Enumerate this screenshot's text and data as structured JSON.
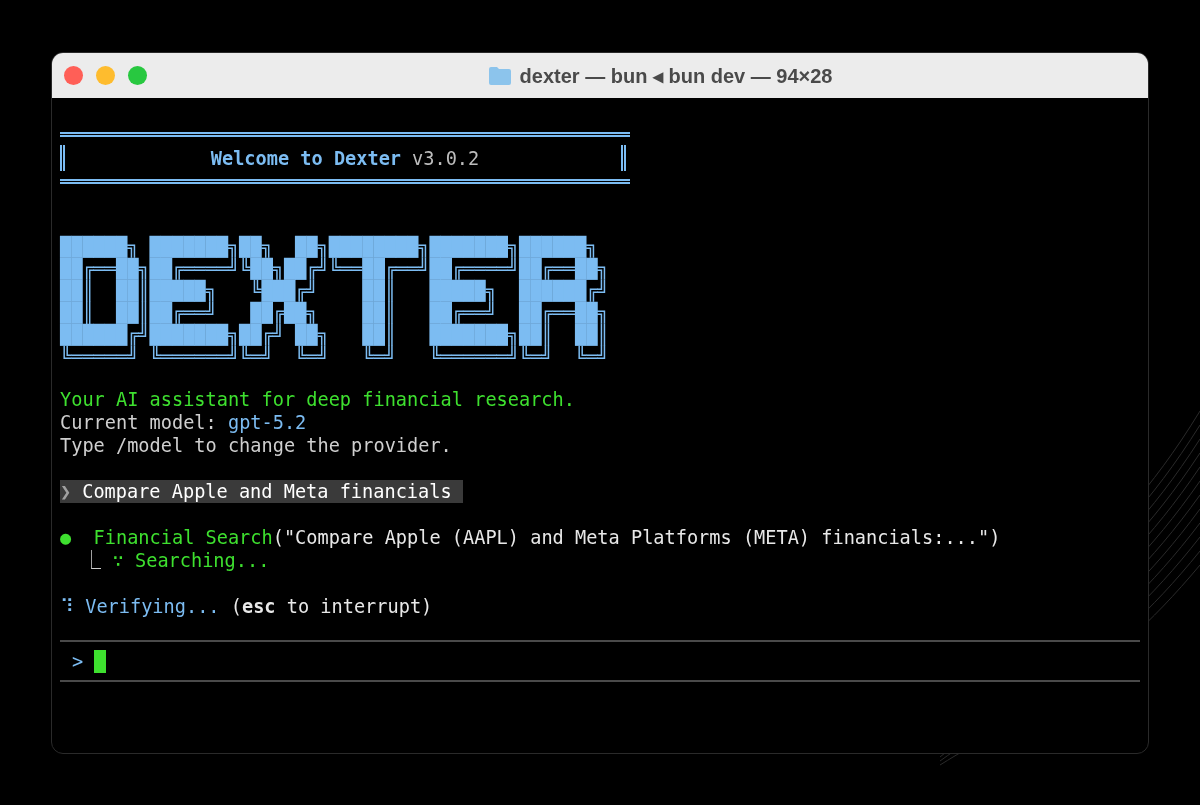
{
  "window": {
    "title": "dexter — bun ◂ bun dev — 94×28"
  },
  "welcome": {
    "title": "Welcome to Dexter",
    "version": "v3.0.2"
  },
  "banner_art": [
    "██████╗ ███████╗██╗  ██╗████████╗███████╗██████╗ ",
    "██╔══██╗██╔════╝╚██╗██╔╝╚══██╔══╝██╔════╝██╔══██╗",
    "██║  ██║█████╗   ╚███╔╝    ██║   █████╗  ██████╔╝",
    "██║  ██║██╔══╝   ██╔██╗    ██║   ██╔══╝  ██╔══██╗",
    "██████╔╝███████╗██╔╝ ██╗   ██║   ███████╗██║  ██║",
    "╚═════╝ ╚══════╝╚═╝  ╚═╝   ╚═╝   ╚══════╝╚═╝  ╚═╝"
  ],
  "tagline": "Your AI assistant for deep financial research.",
  "model": {
    "label": "Current model:",
    "value": "gpt-5.2"
  },
  "hint": "Type /model to change the provider.",
  "query": {
    "marker": "❯",
    "text": "Compare Apple and Meta financials"
  },
  "tool_call": {
    "dot": "●",
    "name": "Financial Search",
    "args": "(\"Compare Apple (AAPL) and Meta Platforms (META) financials:...\")",
    "branch": "⎿",
    "spinner": "∵",
    "status": "Searching..."
  },
  "progress": {
    "spinner": "⠹",
    "label": "Verifying...",
    "hint_open": "(",
    "key": "esc",
    "hint_close": "to interrupt)"
  },
  "prompt": {
    "symbol": ">",
    "cursor": true
  }
}
